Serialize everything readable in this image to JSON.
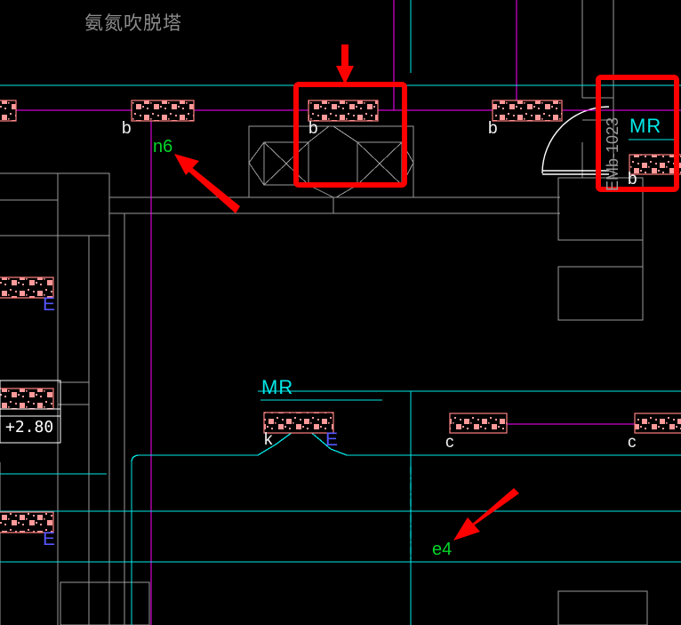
{
  "drawing": {
    "title_cn": "氨氮吹脱塔",
    "background_color": "#000000",
    "elevation_marker": "+2.80",
    "colors": {
      "rebar_block_fill": "#ff9a9a",
      "rebar_block_border": "#ff8080",
      "magenta_line": "#ff00ff",
      "cyan_line": "#00e8e8",
      "gray_line": "#9a9a9a",
      "white_line": "#ffffff",
      "highlight_red": "#fe0000",
      "green_text": "#00d72a",
      "blue_text": "#5555ff"
    }
  },
  "labels": {
    "beam_b_1": "b",
    "beam_b_2": "b",
    "beam_b_3": "b",
    "beam_b_4": "b",
    "slab_e_left_upper": "E",
    "slab_e_left_lower": "E",
    "slab_e_mid": "E",
    "beam_k": "k",
    "beam_c_left": "c",
    "beam_c_right": "c",
    "zone_mr_right": "MR",
    "zone_mr_mid": "MR",
    "axis_tag_vertical": "EMb-1023"
  },
  "annotations": {
    "callout_n6": "n6",
    "callout_e4": "e4",
    "highlight_box_main": "red-rectangle-highlight",
    "highlight_box_right": "red-rectangle-highlight",
    "arrow_top": "red-arrow-down",
    "arrow_n6": "red-arrow-upleft",
    "arrow_e4": "red-arrow-downleft"
  }
}
